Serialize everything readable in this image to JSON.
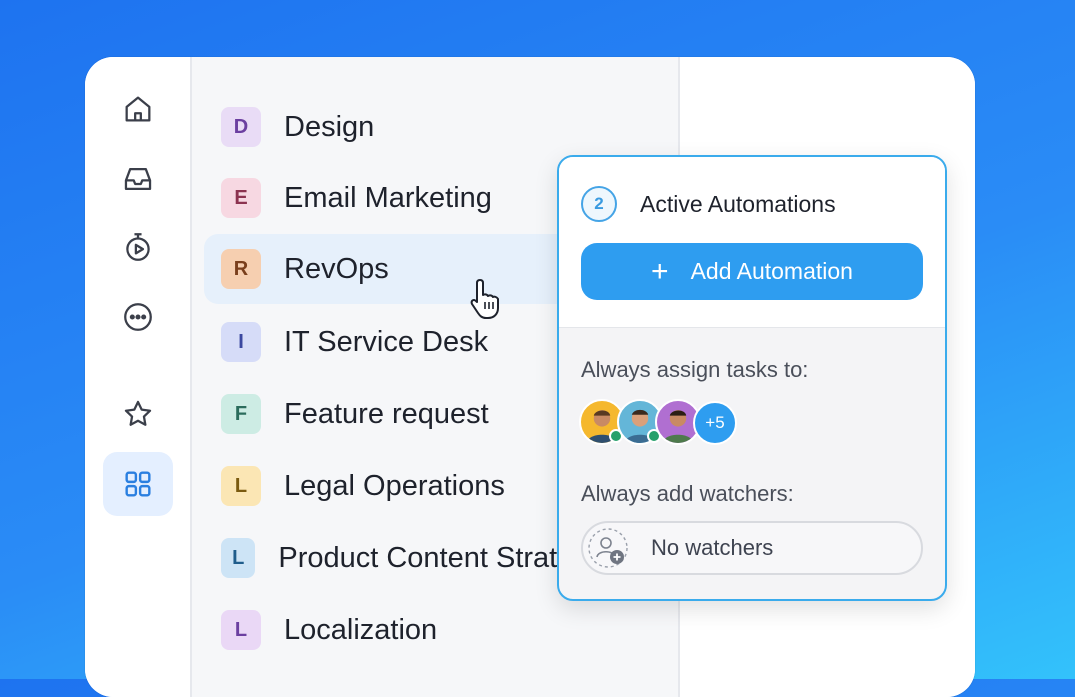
{
  "rail": {
    "items": [
      {
        "icon": "home-icon"
      },
      {
        "icon": "inbox-icon"
      },
      {
        "icon": "timer-icon"
      },
      {
        "icon": "more-icon"
      },
      {
        "icon": "star-icon"
      },
      {
        "icon": "grid-icon",
        "active": true
      }
    ]
  },
  "spaces": [
    {
      "letter": "D",
      "label": "Design",
      "badge_bg": "#e9dcf6",
      "badge_fg": "#6b3fa0"
    },
    {
      "letter": "E",
      "label": "Email Marketing",
      "badge_bg": "#f7d8e2",
      "badge_fg": "#8c3350"
    },
    {
      "letter": "R",
      "label": "RevOps",
      "badge_bg": "#f6cfb0",
      "badge_fg": "#7a3f1c"
    },
    {
      "letter": "I",
      "label": "IT Service Desk",
      "badge_bg": "#d6dcf8",
      "badge_fg": "#3b48a0"
    },
    {
      "letter": "F",
      "label": "Feature request",
      "badge_bg": "#cdece4",
      "badge_fg": "#2b6c5c"
    },
    {
      "letter": "L",
      "label": "Legal Operations",
      "badge_bg": "#fbe6b4",
      "badge_fg": "#7a5a0f"
    },
    {
      "letter": "L",
      "label": "Product Content Strategy",
      "badge_bg": "#cde4f6",
      "badge_fg": "#1f5d8c"
    },
    {
      "letter": "L",
      "label": "Localization",
      "badge_bg": "#ead8f6",
      "badge_fg": "#6b3fa0"
    }
  ],
  "hovered_space": "RevOps",
  "popup": {
    "count": "2",
    "title": "Active Automations",
    "add_button_label": "Add Automation",
    "assign_label": "Always assign tasks to:",
    "assignee_overflow": "+5",
    "watchers_label": "Always add watchers:",
    "watchers_value": "No watchers"
  },
  "colors": {
    "accent": "#2e9df0",
    "popup_border": "#3aabec",
    "online": "#27a06b"
  }
}
